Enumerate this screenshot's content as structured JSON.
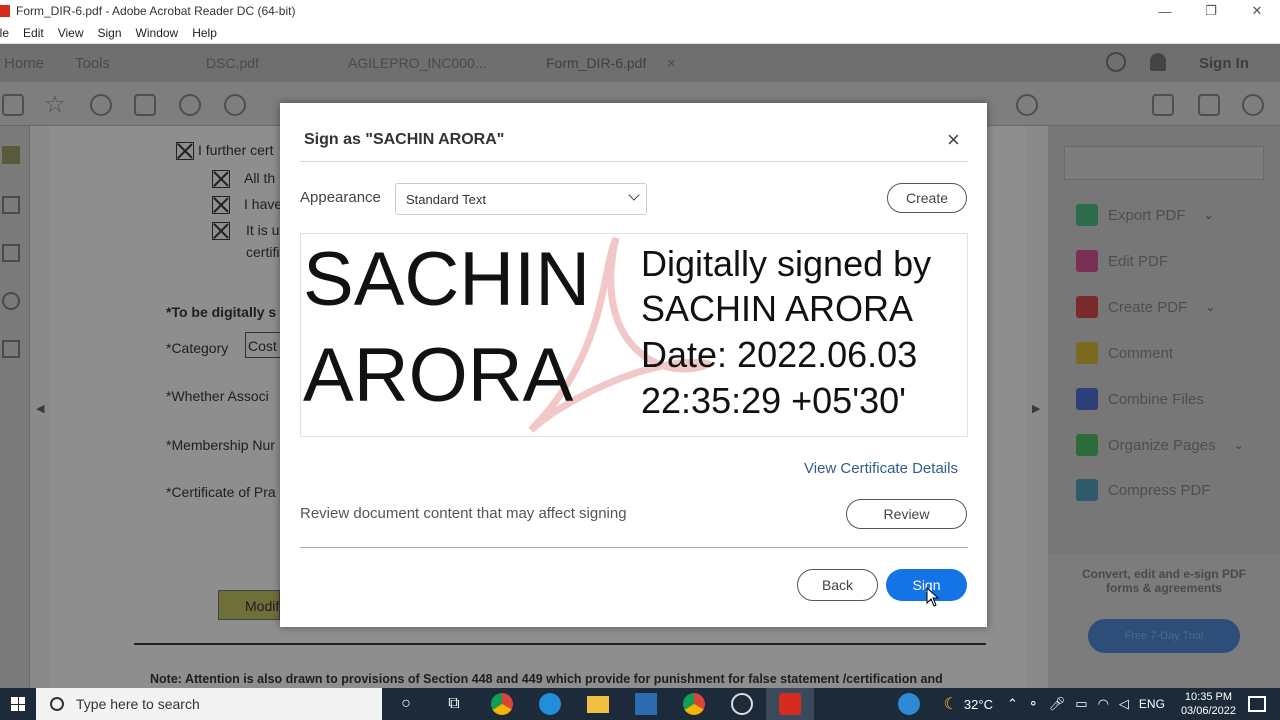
{
  "window": {
    "title": "Form_DIR-6.pdf - Adobe Acrobat Reader DC (64-bit)",
    "minimize": "—",
    "maximize": "❐",
    "close": "✕"
  },
  "menu": [
    "ile",
    "Edit",
    "View",
    "Sign",
    "Window",
    "Help"
  ],
  "tabs": {
    "home": "Home",
    "tools": "Tools",
    "doc1": "DSC.pdf",
    "doc2": "AGILEPRO_INC000...",
    "doc3": "Form_DIR-6.pdf",
    "doc3_close": "×",
    "signin": "Sign In"
  },
  "document": {
    "line1": "I further  cert",
    "line2": "All th",
    "line3": "I have",
    "line4": "It is u",
    "line5": "certifi",
    "digitally": "*To be digitally s",
    "category": "*Category",
    "category_value": "Cost",
    "whether": "*Whether  Associ",
    "membership": "*Membership Nur",
    "certificate": "*Certificate of Pra",
    "modify": "Modif",
    "note": "Note: Attention is also drawn to provisions of Section 448 and 449 which provide for punishment for false statement /certification and punishment for false evidence respectively."
  },
  "right_panel": {
    "items": [
      {
        "label": "Export PDF",
        "color": "#2e6b4a",
        "chevron": true
      },
      {
        "label": "Edit PDF",
        "color": "#7a2f55",
        "chevron": false
      },
      {
        "label": "Create PDF",
        "color": "#7a2a2a",
        "chevron": true
      },
      {
        "label": "Comment",
        "color": "#7a6a20",
        "chevron": false
      },
      {
        "label": "Combine Files",
        "color": "#2f3f7a",
        "chevron": false
      },
      {
        "label": "Organize Pages",
        "color": "#2e6b3a",
        "chevron": true
      },
      {
        "label": "Compress PDF",
        "color": "#2e5a6b",
        "chevron": false
      }
    ],
    "promo": "Convert, edit and e-sign PDF forms & agreements",
    "trial": "Free 7-Day Trial"
  },
  "dialog": {
    "title": "Sign as \"SACHIN ARORA\"",
    "close": "×",
    "appearance_label": "Appearance",
    "appearance_value": "Standard Text",
    "create": "Create",
    "sig_line1": "SACHIN",
    "sig_line2": "ARORA",
    "detail_line1": "Digitally signed by",
    "detail_line2": "SACHIN ARORA",
    "detail_line3": "Date: 2022.06.03",
    "detail_line4": "22:35:29 +05'30'",
    "view_cert": "View Certificate Details",
    "review_text": "Review document content that may affect signing",
    "review": "Review",
    "back": "Back",
    "sign": "Sign"
  },
  "taskbar": {
    "search_placeholder": "Type here to search",
    "temperature": "32°C",
    "language": "ENG",
    "time": "10:35 PM",
    "date": "03/06/2022"
  }
}
